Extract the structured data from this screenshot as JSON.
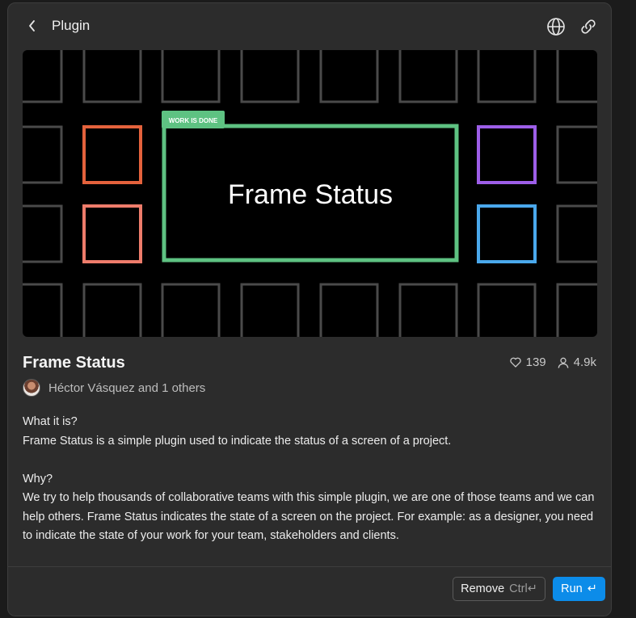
{
  "header": {
    "title": "Plugin",
    "back_icon": "chevron-left-icon",
    "globe_icon": "globe-icon",
    "link_icon": "link-icon"
  },
  "hero": {
    "banner_title": "Frame Status",
    "status_tag": "WORK IS DONE",
    "colors": {
      "green": "#5ec282",
      "orange": "#e4623c",
      "salmon": "#ee7c6b",
      "purple": "#9d5ee8",
      "blue": "#4aa8ec",
      "grid": "#4a4a4a"
    }
  },
  "plugin": {
    "name": "Frame Status",
    "likes": "139",
    "users": "4.9k",
    "author": "Héctor Vásquez and 1 others"
  },
  "description": {
    "q1": "What it is?",
    "a1": "Frame Status is a simple plugin used to indicate the status of a screen of a project.",
    "q2": "Why?",
    "a2": "We try to help thousands of collaborative teams with this simple plugin, we are one of those teams and we can help others. Frame Status indicates the state of a screen on the project. For example: as a designer, you need to indicate the state of your work for your team, stakeholders and clients."
  },
  "footer": {
    "remove_label": "Remove",
    "remove_shortcut": "Ctrl↵",
    "run_label": "Run",
    "run_shortcut": "↵",
    "accent": "#0c8ce9"
  }
}
